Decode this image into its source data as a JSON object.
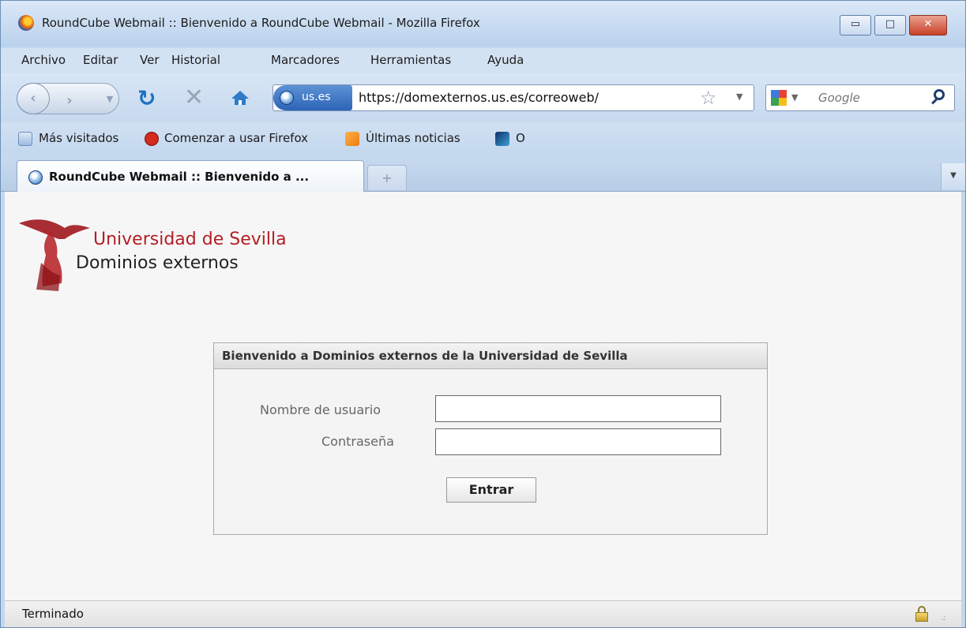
{
  "window": {
    "title": "RoundCube Webmail :: Bienvenido a RoundCube Webmail - Mozilla Firefox",
    "controls": {
      "minimize": "▭",
      "maximize": "□",
      "close": "✕"
    }
  },
  "menu": {
    "items": [
      "Archivo",
      "Editar",
      "Ver",
      "Historial",
      "Marcadores",
      "Herramientas",
      "Ayuda"
    ]
  },
  "navigation": {
    "back_icon": "back-arrow-icon",
    "forward_icon": "forward-arrow-icon",
    "site_identity": "us.es",
    "url": "https://domexternos.us.es/correoweb/",
    "search_placeholder": "Google"
  },
  "bookmarks": {
    "items": [
      "Más visitados",
      "Comenzar a usar Firefox",
      "Últimas noticias",
      "O"
    ]
  },
  "tabs": {
    "active_label": "RoundCube Webmail :: Bienvenido a ...",
    "new_tab_glyph": "+"
  },
  "page": {
    "logo": {
      "university": "Universidad de Sevilla",
      "subtitle": "Dominios externos"
    },
    "login": {
      "header": "Bienvenido a Dominios externos de la Universidad de Sevilla",
      "username_label": "Nombre de usuario",
      "password_label": "Contraseña",
      "username_value": "",
      "password_value": "",
      "submit_label": "Entrar"
    }
  },
  "status": {
    "text": "Terminado"
  },
  "colors": {
    "brand_red": "#b41d24",
    "chrome_blue": "#c3d7ee"
  }
}
